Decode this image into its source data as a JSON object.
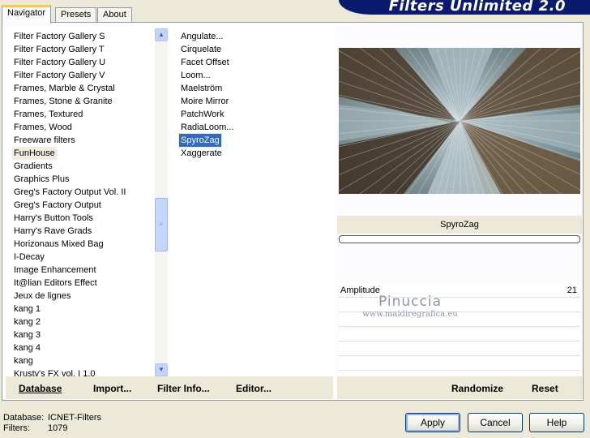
{
  "tabs": [
    {
      "label": "Navigator",
      "active": true
    },
    {
      "label": "Presets",
      "active": false
    },
    {
      "label": "About",
      "active": false
    }
  ],
  "banner": {
    "title": "Filters Unlimited 2.0"
  },
  "categories": {
    "selected": "FunHouse",
    "items": [
      "Filter Factory Gallery S",
      "Filter Factory Gallery T",
      "Filter Factory Gallery U",
      "Filter Factory Gallery V",
      "Frames, Marble & Crystal",
      "Frames, Stone & Granite",
      "Frames, Textured",
      "Frames, Wood",
      "Freeware filters",
      "FunHouse",
      "Gradients",
      "Graphics Plus",
      "Greg's Factory Output Vol. II",
      "Greg's Factory Output",
      "Harry's Button Tools",
      "Harry's Rave Grads",
      "Horizonaus Mixed Bag",
      "I-Decay",
      "Image Enhancement",
      "It@lian Editors Effect",
      "Jeux de lignes",
      "kang 1",
      "kang 2",
      "kang 3",
      "kang 4",
      "kang",
      "Krusty's FX vol. I 1.0"
    ]
  },
  "filters": {
    "selected": "SpyroZag",
    "items": [
      "Angulate...",
      "Cirquelate",
      "Facet Offset",
      "Loom...",
      "Maelström",
      "Moire Mirror",
      "PatchWork",
      "RadiaLoom...",
      "SpyroZag",
      "Xaggerate"
    ]
  },
  "left_buttons": {
    "database": "Database",
    "import": "Import...",
    "filter_info": "Filter Info...",
    "editor": "Editor..."
  },
  "right_buttons": {
    "randomize": "Randomize",
    "reset": "Reset"
  },
  "preview": {
    "filter_name": "SpyroZag",
    "progress": 0
  },
  "sliders": [
    {
      "label": "Amplitude",
      "value": "21"
    }
  ],
  "watermark": {
    "name": "Pinuccia",
    "site": "www.maidiregrafica.eu"
  },
  "footer": {
    "database_label": "Database:",
    "database_value": "ICNET-Filters",
    "filters_label": "Filters:",
    "filters_value": "1079"
  },
  "dialog_buttons": {
    "apply": "Apply",
    "cancel": "Cancel",
    "help": "Help"
  },
  "colors": {
    "selection": "#316ac5",
    "banner": "#0a1a6e",
    "dialog_bg": "#ece9d8"
  }
}
